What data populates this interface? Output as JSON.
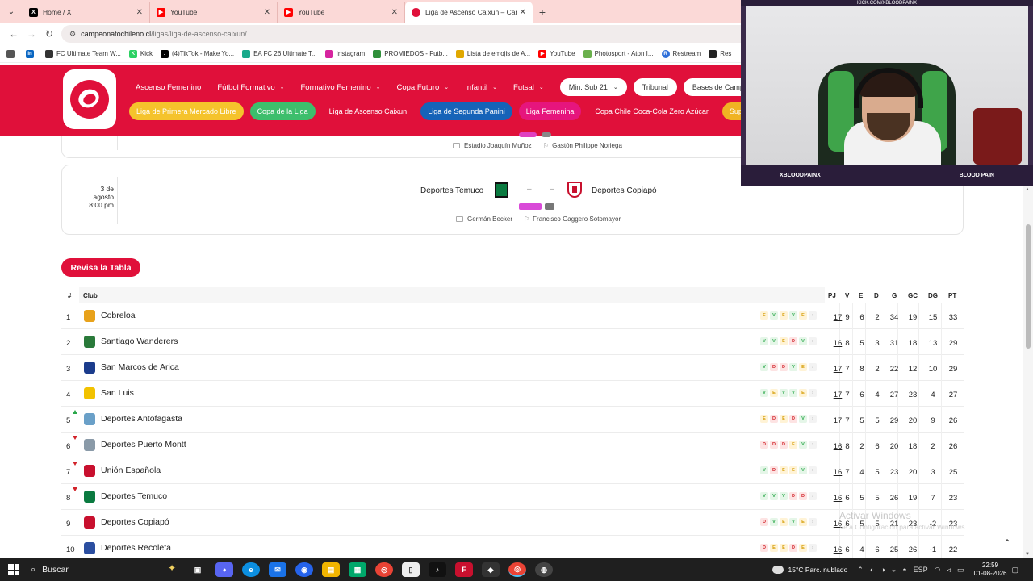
{
  "browser": {
    "tabs": [
      {
        "title": "Home / X",
        "favicon": "x-icon",
        "active": false
      },
      {
        "title": "YouTube",
        "favicon": "youtube-icon",
        "active": false
      },
      {
        "title": "YouTube",
        "favicon": "youtube-icon",
        "active": false
      },
      {
        "title": "Liga de Ascenso Caixun – Camp",
        "favicon": "campeonato-icon",
        "active": true
      }
    ],
    "url_host": "campeonatochileno.cl",
    "url_path": "/ligas/liga-de-ascenso-caixun/",
    "bookmarks": [
      "FC Ultimate Team W...",
      "Kick",
      "(4)TikTok - Make Yo...",
      "EA FC 26 Ultimate T...",
      "Instagram",
      "PROMIEDOS - Futb...",
      "Lista de emojis de A...",
      "YouTube",
      "Photosport - Aton I...",
      "Restream",
      "Res"
    ]
  },
  "site": {
    "nav_row1": [
      "Ascenso Femenino",
      "Fútbol Formativo",
      "Formativo Femenino",
      "Copa Futuro",
      "Infantil",
      "Futsal"
    ],
    "pills_row1": [
      "Min. Sub 21",
      "Tribunal",
      "Bases de Campeonato"
    ],
    "league_pills": [
      {
        "label": "Liga de Primera Mercado Libre",
        "style": "yellow"
      },
      {
        "label": "Copa de la Liga",
        "style": "green"
      },
      {
        "label": "Liga de Ascenso Caixun",
        "style": "plain"
      },
      {
        "label": "Liga de Segunda Panini",
        "style": "blue"
      },
      {
        "label": "Liga Femenina",
        "style": "pink"
      },
      {
        "label": "Copa Chile Coca-Cola Zero Azúcar",
        "style": "plain"
      },
      {
        "label": "Superco",
        "style": "gold"
      }
    ]
  },
  "prev_match": {
    "stadium": "Estadio Joaquín Muñoz",
    "referee": "Gastón Philippe Noriega"
  },
  "match": {
    "date": "3 de agosto",
    "time": "8:00 pm",
    "home": "Deportes Temuco",
    "away": "Deportes Copiapó",
    "score": "– –",
    "stadium": "Germán Becker",
    "referee": "Francisco Gaggero Sotomayor"
  },
  "table": {
    "button": "Revisa la Tabla",
    "headers": {
      "pos": "#",
      "club": "Club",
      "pj": "PJ",
      "v": "V",
      "e": "E",
      "d": "D",
      "g": "G",
      "gc": "GC",
      "dg": "DG",
      "pt": "PT"
    },
    "rows": [
      {
        "pos": "1",
        "club": "Cobreloa",
        "trend": "none",
        "crest": "#e8a21b",
        "form": [
          "E",
          "V",
          "E",
          "V",
          "E"
        ],
        "pj": "17",
        "v": "9",
        "e": "6",
        "d": "2",
        "g": "34",
        "gc": "19",
        "dg": "15",
        "pt": "33"
      },
      {
        "pos": "2",
        "club": "Santiago Wanderers",
        "trend": "none",
        "crest": "#2a7a3a",
        "form": [
          "V",
          "V",
          "E",
          "D",
          "V"
        ],
        "pj": "16",
        "v": "8",
        "e": "5",
        "d": "3",
        "g": "31",
        "gc": "18",
        "dg": "13",
        "pt": "29"
      },
      {
        "pos": "3",
        "club": "San Marcos de Arica",
        "trend": "none",
        "crest": "#1b3c8c",
        "form": [
          "V",
          "D",
          "D",
          "V",
          "E"
        ],
        "pj": "17",
        "v": "7",
        "e": "8",
        "d": "2",
        "g": "22",
        "gc": "12",
        "dg": "10",
        "pt": "29"
      },
      {
        "pos": "4",
        "club": "San Luis",
        "trend": "none",
        "crest": "#f2c200",
        "form": [
          "V",
          "E",
          "V",
          "V",
          "E"
        ],
        "pj": "17",
        "v": "7",
        "e": "6",
        "d": "4",
        "g": "27",
        "gc": "23",
        "dg": "4",
        "pt": "27"
      },
      {
        "pos": "5",
        "club": "Deportes Antofagasta",
        "trend": "up",
        "crest": "#6aa0c8",
        "form": [
          "E",
          "D",
          "E",
          "D",
          "V"
        ],
        "pj": "17",
        "v": "7",
        "e": "5",
        "d": "5",
        "g": "29",
        "gc": "20",
        "dg": "9",
        "pt": "26"
      },
      {
        "pos": "6",
        "club": "Deportes Puerto Montt",
        "trend": "down",
        "crest": "#8a9aa8",
        "form": [
          "D",
          "D",
          "D",
          "E",
          "V"
        ],
        "pj": "16",
        "v": "8",
        "e": "2",
        "d": "6",
        "g": "20",
        "gc": "18",
        "dg": "2",
        "pt": "26"
      },
      {
        "pos": "7",
        "club": "Unión Española",
        "trend": "down",
        "crest": "#c8102e",
        "form": [
          "V",
          "D",
          "E",
          "E",
          "V"
        ],
        "pj": "16",
        "v": "7",
        "e": "4",
        "d": "5",
        "g": "23",
        "gc": "20",
        "dg": "3",
        "pt": "25"
      },
      {
        "pos": "8",
        "club": "Deportes Temuco",
        "trend": "down",
        "crest": "#0a7a40",
        "form": [
          "V",
          "V",
          "V",
          "D",
          "D"
        ],
        "pj": "16",
        "v": "6",
        "e": "5",
        "d": "5",
        "g": "26",
        "gc": "19",
        "dg": "7",
        "pt": "23"
      },
      {
        "pos": "9",
        "club": "Deportes Copiapó",
        "trend": "none",
        "crest": "#c8102e",
        "form": [
          "D",
          "V",
          "E",
          "V",
          "E"
        ],
        "pj": "16",
        "v": "6",
        "e": "5",
        "d": "5",
        "g": "21",
        "gc": "23",
        "dg": "-2",
        "pt": "23"
      },
      {
        "pos": "10",
        "club": "Deportes Recoleta",
        "trend": "none",
        "crest": "#2b4ea0",
        "form": [
          "D",
          "E",
          "E",
          "D",
          "E"
        ],
        "pj": "16",
        "v": "6",
        "e": "4",
        "d": "6",
        "g": "25",
        "gc": "26",
        "dg": "-1",
        "pt": "22"
      }
    ]
  },
  "watermark": {
    "title": "Activar Windows",
    "subtitle": "Ve a Configuración para activar Windows."
  },
  "webcam": {
    "top_text": "KICK.COM/XBLOODPAINX",
    "left_tag": "XBLOODPAINX",
    "right_tag": "BLOOD PAIN"
  },
  "taskbar": {
    "search": "Buscar",
    "weather": "15°C  Parc. nublado",
    "lang": "ESP",
    "time": "22:59",
    "date": "01-08-2026"
  },
  "colors": {
    "brand": "#e0103a",
    "win": "#2aa84a",
    "draw": "#d49b00",
    "loss": "#d2232a"
  }
}
